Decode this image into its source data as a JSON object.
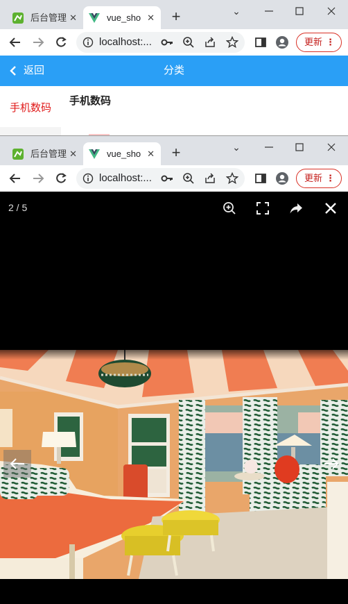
{
  "windows": [
    {
      "tabs": [
        {
          "title": "后台管理",
          "active": false
        },
        {
          "title": "vue_sho",
          "active": true
        }
      ],
      "address": "localhost:...",
      "update_label": "更新"
    },
    {
      "tabs": [
        {
          "title": "后台管理",
          "active": false
        },
        {
          "title": "vue_sho",
          "active": true
        }
      ],
      "address": "localhost:...",
      "update_label": "更新"
    }
  ],
  "page": {
    "header": {
      "back_label": "返回",
      "title": "分类"
    },
    "sidebar": {
      "items": [
        {
          "label": "手机数码",
          "selected": true
        }
      ]
    },
    "content": {
      "category_title": "手机数码"
    }
  },
  "viewer": {
    "counter": "2 / 5",
    "colors": {
      "background": "#000000",
      "accent": "#2a9ff6",
      "selected": "#e01a1a"
    }
  }
}
